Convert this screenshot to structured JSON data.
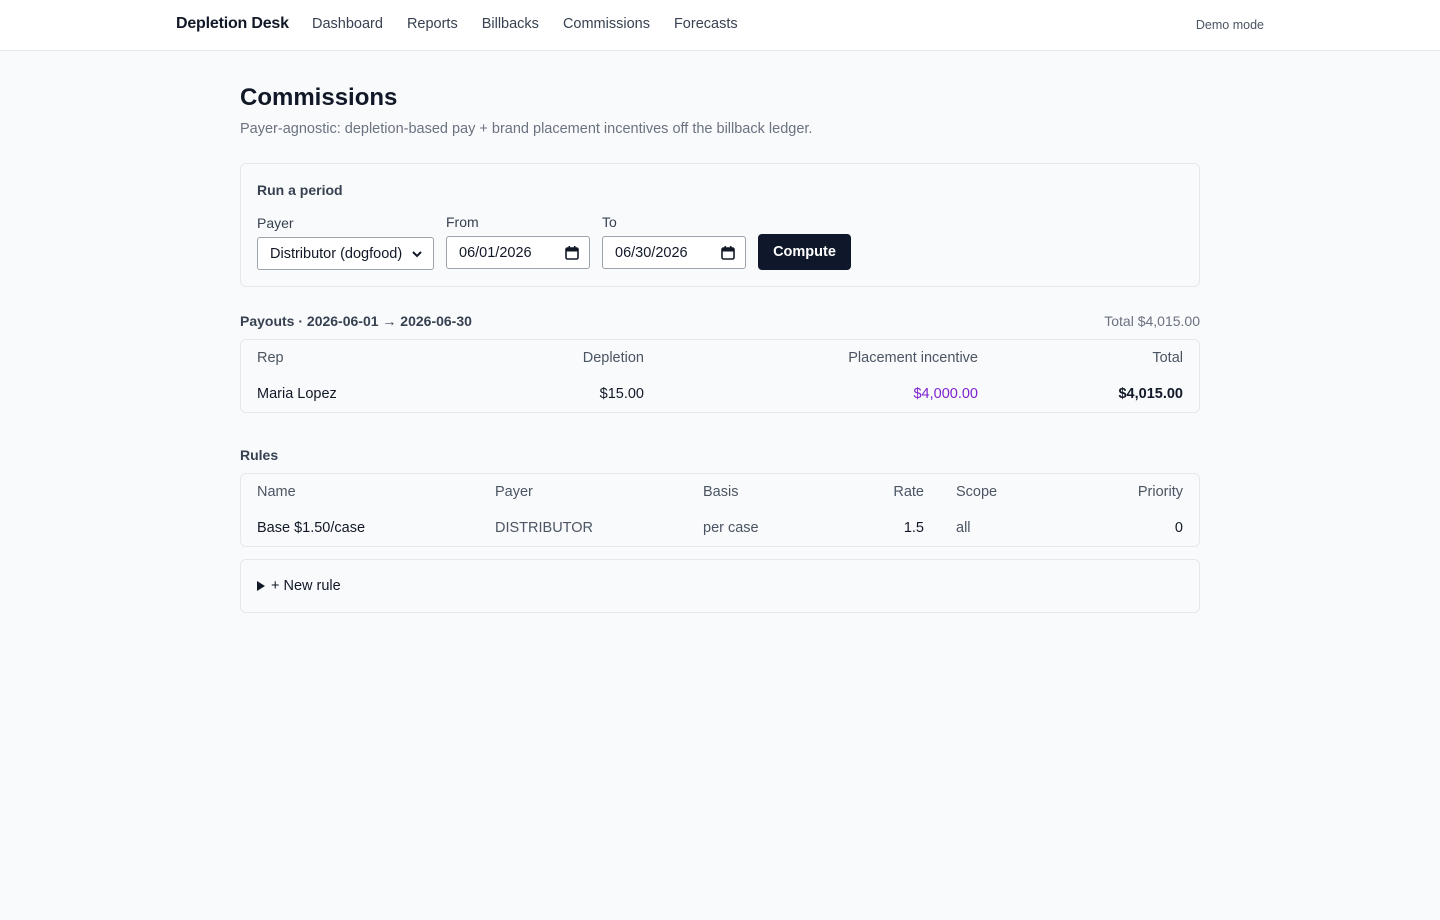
{
  "app": {
    "brand": "Depletion Desk",
    "mode": "Demo mode"
  },
  "nav": [
    "Dashboard",
    "Reports",
    "Billbacks",
    "Commissions",
    "Forecasts"
  ],
  "page": {
    "title": "Commissions",
    "subtitle": "Payer-agnostic: depletion-based pay + brand placement incentives off the billback ledger."
  },
  "run": {
    "heading": "Run a period",
    "payer_label": "Payer",
    "payer_value": "Distributor (dogfood)",
    "from_label": "From",
    "from_value": "06/01/2026",
    "to_label": "To",
    "to_value": "06/30/2026",
    "compute_label": "Compute"
  },
  "payouts": {
    "heading": "Payouts · 2026-06-01 → 2026-06-30",
    "total": "Total $4,015.00",
    "columns": [
      "Rep",
      "Depletion",
      "Placement incentive",
      "Total"
    ],
    "rows": [
      {
        "rep": "Maria Lopez",
        "depletion": "$15.00",
        "incentive": "$4,000.00",
        "total": "$4,015.00"
      }
    ]
  },
  "rules": {
    "heading": "Rules",
    "columns": [
      "Name",
      "Payer",
      "Basis",
      "Rate",
      "Scope",
      "Priority"
    ],
    "rows": [
      {
        "name": "Base $1.50/case",
        "payer": "DISTRIBUTOR",
        "basis": "per case",
        "rate": "1.5",
        "scope": "all",
        "priority": "0"
      }
    ],
    "new_rule_label": "+ New rule"
  },
  "colors": {
    "accent": "#0f172a",
    "incentive": "#7e22ce",
    "border": "#e5e7eb"
  }
}
